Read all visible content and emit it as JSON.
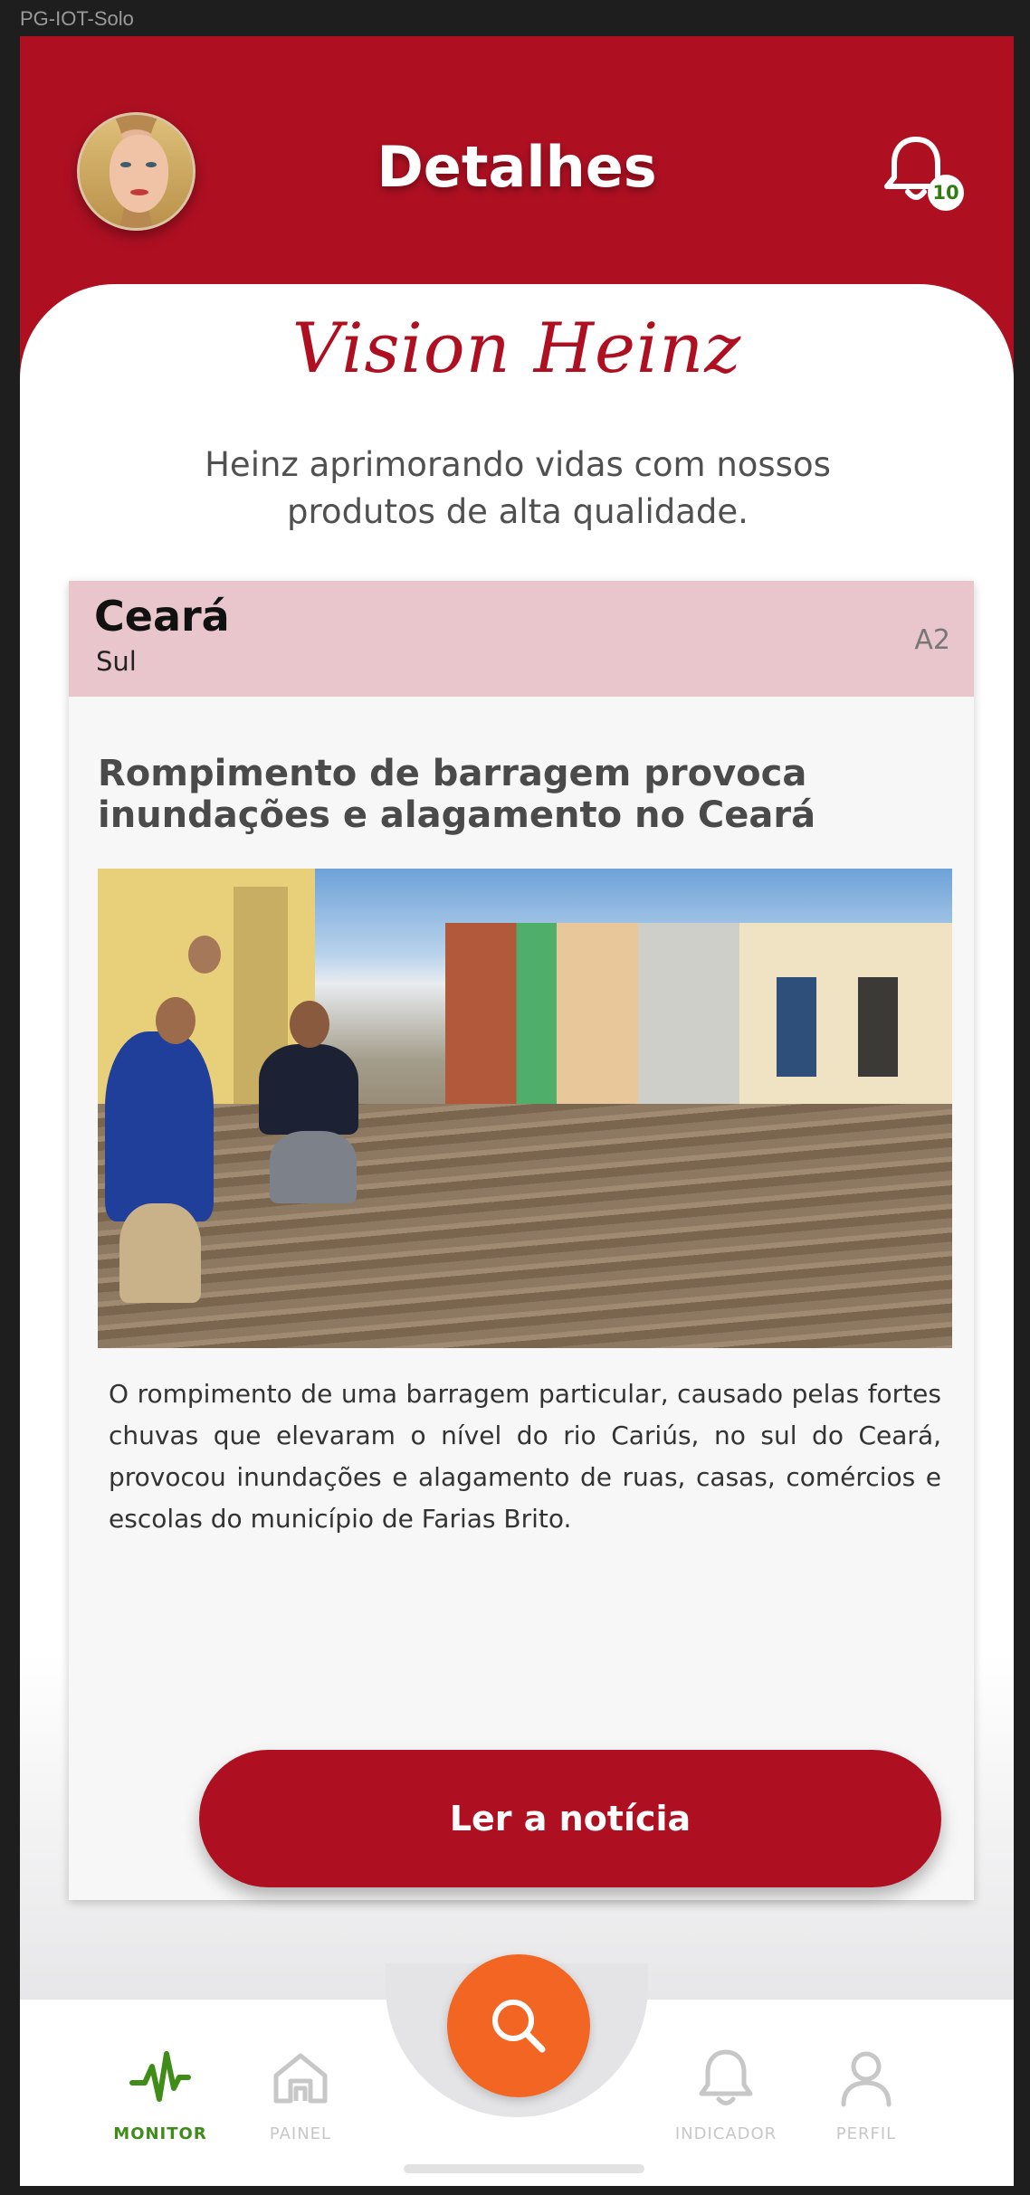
{
  "window": {
    "label": "PG-IOT-Solo"
  },
  "header": {
    "title": "Detalhes",
    "notifications_count": "10"
  },
  "brand": {
    "name": "Vision Heinz"
  },
  "tagline": "Heinz aprimorando vidas com nossos produtos de alta qualidade.",
  "card": {
    "state": "Ceará",
    "region": "Sul",
    "code": "A2",
    "headline": "Rompimento de barragem provoca inundações e alagamento no Ceará",
    "body": "O rompimento de uma barragem particular, causado pelas fortes chuvas que elevaram o nível do rio Cariús, no sul do Ceará, provocou inundações e alagamento de ruas, casas, comércios e escolas do município de Farias Brito.",
    "button_label": "Ler a notícia"
  },
  "tabbar": {
    "items": [
      {
        "label": "MONITOR",
        "icon": "pulse-icon",
        "active": true
      },
      {
        "label": "PAINEL",
        "icon": "home-icon",
        "active": false
      },
      {
        "label": "INDICADOR",
        "icon": "bell-icon",
        "active": false
      },
      {
        "label": "PERFIL",
        "icon": "user-icon",
        "active": false
      }
    ],
    "fab_icon": "search-icon"
  },
  "colors": {
    "brand_red": "#ae1022",
    "header_pink": "#e9c6cb",
    "accent_orange": "#f26522",
    "active_green": "#3f8c19"
  }
}
